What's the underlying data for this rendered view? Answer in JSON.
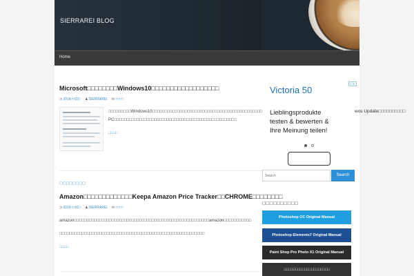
{
  "site": {
    "title": "SIERRAREI BLOG"
  },
  "nav": {
    "home": "Home"
  },
  "posts": [
    {
      "title": "Microsoft□□□□□□□□Windows10□□□□□□□□□□□□□□□□□□",
      "date": "2016□□02□",
      "author": "SIERRAREI",
      "comments": "□□□□",
      "excerpt_lines": [
        "□□□□□□□□□Windows10□□□□□□□□□□□□□□□□□□□□□□□□□□□□□□□□□□□□□□□□□□□□□□□□□□□",
        "PC□□□□□□□□□□□□□□□□□□□□□□□□□□□□□□□□□□□□□□□□□□□□□□□□□"
      ],
      "read_more": "□□□□"
    },
    {
      "category": "□□□□□□□□",
      "title": "Amazon□□□□□□□□□□□□□Keepa Amazon Price Tracker□□CHROME□□□□□□□□",
      "date": "2016□□01□",
      "author": "SIERRAREI",
      "comments": "□□□□",
      "excerpt_lines": [
        "amazon□□□□□□□□□□□□□□□□□□□□□□□□□□□□□□□□□□□□□□□□□□□□□□□□□□□□□□amazon□□□□□□□□□□□",
        "□□□□□□□□□□□□□□□□□□□□□□□□□□□□□□□□□□□□□□□□□□□□□□□□□□□□□□□□□□"
      ],
      "read_more": "□□□□"
    }
  ],
  "ad": {
    "title": "Victoria 50",
    "lines": [
      "Lieblingsprodukte",
      "testen & bewerten &",
      "Ihre Meinung teilen!"
    ],
    "badge": "▷✕"
  },
  "overflow_text": "wos Update□□□□□□□□□□",
  "search": {
    "placeholder": "Search",
    "button": "Search"
  },
  "sidebar": {
    "widget_title": "□□□□□□□□□□",
    "banners": [
      {
        "label": "Photoshop CC Original Manual",
        "color": "#1f9fe0"
      },
      {
        "label": "Photoshop Elements7 Original Manual",
        "color": "#1e4f94"
      },
      {
        "label": "Paint Shop Pro Photo X1 Original Manual",
        "color": "#2a2a2a"
      },
      {
        "label": "□□□□□□□□□□□□□□□□□□□□",
        "color": "#333333"
      }
    ]
  },
  "colors": {
    "accent": "#3a8fd0",
    "header_bg": "#1e2830",
    "nav_bg": "#3a3a3a"
  }
}
